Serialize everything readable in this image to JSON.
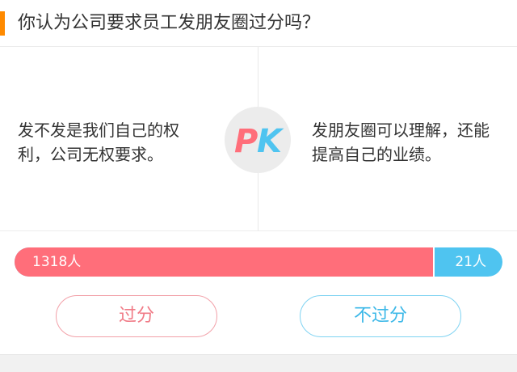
{
  "question": "你认为公司要求员工发朋友圈过分吗？",
  "pk": {
    "left_opinion": "发不发是我们自己的权利，公司无权要求。",
    "right_opinion": "发朋友圈可以理解，还能提高自己的业绩。",
    "badge_letter_p": "P",
    "badge_letter_k": "K"
  },
  "vote_bar": {
    "left_count_label": "1318人",
    "right_count_label": "21人",
    "left_fraction": 0.861
  },
  "buttons": {
    "left_label": "过分",
    "right_label": "不过分"
  },
  "colors": {
    "accent": "#ff8a00",
    "left_side": "#ff6e7a",
    "right_side": "#4fc4f0"
  }
}
